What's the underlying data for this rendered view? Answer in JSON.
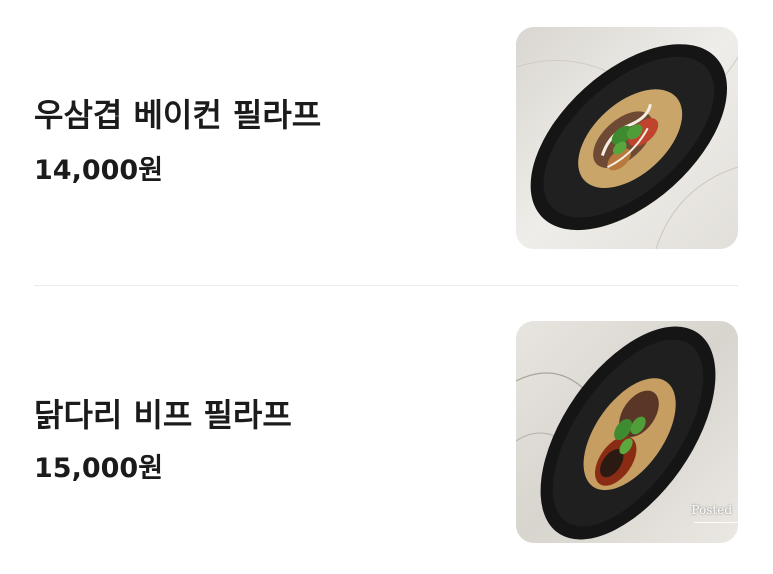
{
  "menu": {
    "items": [
      {
        "name": "우삼겹 베이컨 필라프",
        "price": "14,000원",
        "image": "food-photo-pilaf-bacon"
      },
      {
        "name": "닭다리 비프 필라프",
        "price": "15,000원",
        "image": "food-photo-pilaf-chicken-beef",
        "watermark": "Posted"
      }
    ]
  },
  "colors": {
    "text": "#1b1b1b",
    "divider": "#ececec",
    "plate": "#1a1a1a",
    "marble": "#ece9e4"
  }
}
